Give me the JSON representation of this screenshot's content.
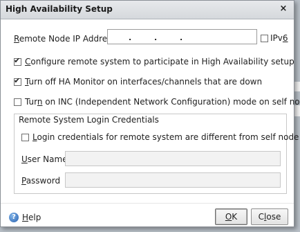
{
  "dialog": {
    "title": "High Availability Setup",
    "close_glyph": "×"
  },
  "ip": {
    "label_pre": "",
    "label_ul": "R",
    "label_post": "emote Node IP Address",
    "dots": [
      ".",
      ".",
      "."
    ],
    "ipv6_label_pre": "IPv",
    "ipv6_label_ul": "6",
    "ipv6_checked": false
  },
  "options": [
    {
      "pre": "",
      "ul": "C",
      "post": "onfigure remote system to participate in High Availability setup",
      "checked": true
    },
    {
      "pre": "",
      "ul": "T",
      "post": "urn off HA Monitor on interfaces/channels that are down",
      "checked": true
    },
    {
      "pre": "Tur",
      "ul": "n",
      "post": " on INC (Independent Network Configuration) mode on self node",
      "checked": false
    }
  ],
  "credentials": {
    "legend": "Remote System Login Credentials",
    "different_pre": "",
    "different_ul": "L",
    "different_post": "ogin credentials for remote system are different from self node",
    "different_checked": false,
    "username_pre": "",
    "username_ul": "U",
    "username_post": "ser Name",
    "username_value": "",
    "password_pre": "",
    "password_ul": "P",
    "password_post": "assword",
    "password_value": ""
  },
  "footer": {
    "help_icon": "help-icon",
    "help_pre": "",
    "help_ul": "H",
    "help_post": "elp",
    "ok_pre": "",
    "ok_ul": "O",
    "ok_post": "K",
    "close_pre": "C",
    "close_ul": "l",
    "close_post": "ose"
  }
}
